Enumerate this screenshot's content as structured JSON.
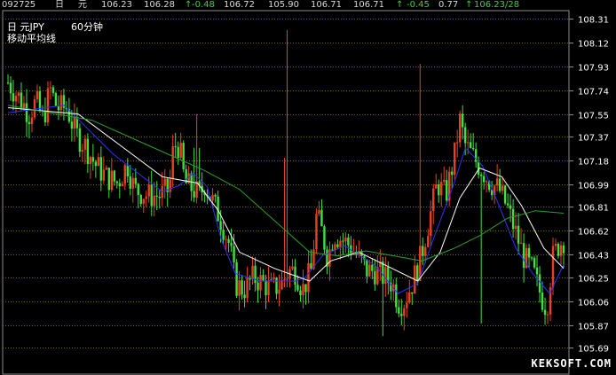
{
  "quote_bar": {
    "date": "092725",
    "name_a": "日",
    "name_b": "元",
    "open": "106.23",
    "high": "106.28",
    "arrow": "↑",
    "change": "-0.48",
    "v1": "106.72",
    "v2": "105.90",
    "v3": "106.71",
    "v4": "106.71",
    "arrow2": "↑",
    "change2": "-0.45",
    "pct": "0.77",
    "arrow3": "↑",
    "last": "106.23/28"
  },
  "header": {
    "symbol": "日  元JPY",
    "period": "60分钟",
    "indicator": "移动平均线"
  },
  "watermark": "KEKSOFT.COM",
  "colors": {
    "background": "#000000",
    "frame": "#8c8c8c",
    "grid": "#7a6a00",
    "candle_up": "#e84020",
    "candle_down": "#3fe03f",
    "ma_short": "#3030ff",
    "ma_mid": "#ffffff",
    "ma_long": "#2aa02a"
  },
  "chart_data": {
    "type": "candlestick",
    "title": "",
    "ylim": [
      105.58,
      108.36
    ],
    "y_ticks": [
      "108.31",
      "108.12",
      "107.93",
      "107.74",
      "107.55",
      "107.37",
      "107.18",
      "106.99",
      "106.81",
      "106.62",
      "106.43",
      "106.25",
      "106.06",
      "105.87",
      "105.69"
    ],
    "grid": true,
    "bar_count": 210,
    "series": [
      {
        "name": "",
        "kind": "price_path",
        "points": [
          [
            0,
            107.8
          ],
          [
            10,
            107.65
          ],
          [
            15,
            107.55
          ],
          [
            20,
            107.65
          ],
          [
            25,
            107.5
          ],
          [
            30,
            107.75
          ],
          [
            35,
            107.6
          ],
          [
            42,
            107.6
          ],
          [
            48,
            107.4
          ],
          [
            55,
            107.3
          ],
          [
            62,
            107.15
          ],
          [
            70,
            107.05
          ],
          [
            78,
            107.0
          ],
          [
            85,
            107.15
          ],
          [
            90,
            106.95
          ],
          [
            100,
            106.9
          ],
          [
            108,
            106.9
          ],
          [
            115,
            106.95
          ],
          [
            118,
            107.3
          ],
          [
            122,
            107.3
          ],
          [
            126,
            107.0
          ],
          [
            132,
            106.95
          ],
          [
            137,
            106.9
          ],
          [
            140,
            107.0
          ],
          [
            148,
            106.8
          ],
          [
            152,
            106.7
          ],
          [
            158,
            106.5
          ],
          [
            162,
            106.2
          ],
          [
            168,
            106.15
          ],
          [
            175,
            106.25
          ],
          [
            182,
            106.2
          ],
          [
            188,
            106.15
          ],
          [
            195,
            106.2
          ],
          [
            200,
            106.3
          ],
          [
            205,
            106.3
          ],
          [
            210,
            106.15
          ],
          [
            212,
            106.2
          ],
          [
            216,
            106.3
          ],
          [
            220,
            106.75
          ],
          [
            224,
            106.6
          ],
          [
            228,
            106.4
          ],
          [
            232,
            106.6
          ],
          [
            238,
            106.55
          ],
          [
            244,
            106.5
          ],
          [
            250,
            106.4
          ],
          [
            256,
            106.3
          ],
          [
            262,
            106.3
          ],
          [
            268,
            106.25
          ],
          [
            274,
            106.2
          ],
          [
            278,
            106.05
          ],
          [
            282,
            106.05
          ],
          [
            288,
            106.2
          ],
          [
            294,
            106.4
          ],
          [
            300,
            106.7
          ],
          [
            306,
            107.0
          ],
          [
            312,
            106.9
          ],
          [
            318,
            107.2
          ],
          [
            322,
            107.5
          ],
          [
            326,
            107.3
          ],
          [
            332,
            107.2
          ],
          [
            338,
            107.1
          ],
          [
            344,
            107.0
          ],
          [
            350,
            106.95
          ],
          [
            356,
            106.8
          ],
          [
            362,
            106.6
          ],
          [
            368,
            106.4
          ],
          [
            374,
            106.3
          ],
          [
            380,
            106.1
          ],
          [
            384,
            106.0
          ],
          [
            388,
            106.4
          ],
          [
            392,
            106.5
          ],
          [
            396,
            106.55
          ]
        ]
      },
      {
        "name": "",
        "kind": "moving_average_short",
        "points": [
          [
            0,
            107.56
          ],
          [
            40,
            107.62
          ],
          [
            75,
            107.23
          ],
          [
            110,
            106.93
          ],
          [
            122,
            106.98
          ],
          [
            132,
            107.08
          ],
          [
            142,
            106.97
          ],
          [
            152,
            106.55
          ],
          [
            162,
            106.28
          ],
          [
            180,
            106.22
          ],
          [
            205,
            106.22
          ],
          [
            212,
            106.25
          ],
          [
            224,
            106.42
          ],
          [
            240,
            106.5
          ],
          [
            262,
            106.34
          ],
          [
            278,
            106.12
          ],
          [
            292,
            106.2
          ],
          [
            304,
            106.58
          ],
          [
            318,
            107.0
          ],
          [
            326,
            107.28
          ],
          [
            338,
            107.14
          ],
          [
            350,
            106.82
          ],
          [
            362,
            106.48
          ],
          [
            374,
            106.28
          ],
          [
            386,
            106.12
          ],
          [
            396,
            106.35
          ]
        ]
      },
      {
        "name": "",
        "kind": "moving_average_mid",
        "points": [
          [
            0,
            107.6
          ],
          [
            50,
            107.55
          ],
          [
            80,
            107.3
          ],
          [
            110,
            107.05
          ],
          [
            135,
            107.0
          ],
          [
            150,
            106.78
          ],
          [
            165,
            106.45
          ],
          [
            190,
            106.32
          ],
          [
            215,
            106.22
          ],
          [
            230,
            106.38
          ],
          [
            250,
            106.45
          ],
          [
            272,
            106.33
          ],
          [
            292,
            106.22
          ],
          [
            308,
            106.45
          ],
          [
            322,
            106.88
          ],
          [
            336,
            107.12
          ],
          [
            352,
            107.05
          ],
          [
            366,
            106.82
          ],
          [
            382,
            106.48
          ],
          [
            396,
            106.32
          ]
        ]
      },
      {
        "name": "",
        "kind": "moving_average_long",
        "points": [
          [
            0,
            107.62
          ],
          [
            60,
            107.5
          ],
          [
            100,
            107.3
          ],
          [
            140,
            107.1
          ],
          [
            165,
            106.95
          ],
          [
            190,
            106.7
          ],
          [
            215,
            106.45
          ],
          [
            235,
            106.42
          ],
          [
            255,
            106.46
          ],
          [
            275,
            106.42
          ],
          [
            295,
            106.38
          ],
          [
            318,
            106.48
          ],
          [
            336,
            106.58
          ],
          [
            356,
            106.72
          ],
          [
            376,
            106.78
          ],
          [
            396,
            106.76
          ]
        ]
      }
    ]
  }
}
